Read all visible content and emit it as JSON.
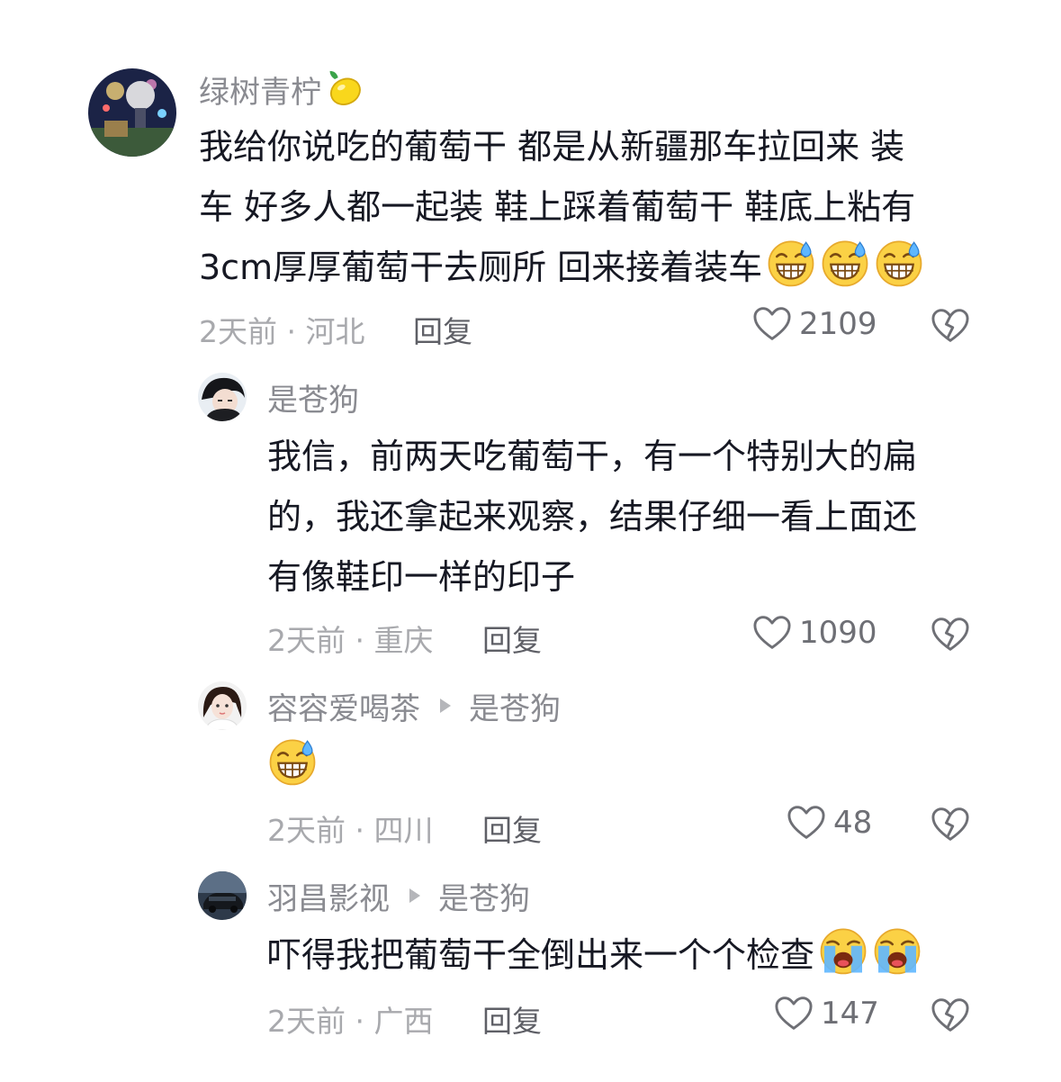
{
  "comments": [
    {
      "username": "绿树青柠",
      "text": [
        "我给你说吃的葡萄干 都是从新疆那车拉回来 装",
        "车 好多人都一起装 鞋上踩着葡萄干 鞋底上粘有",
        "3cm厚厚葡萄干去厕所 回来接着装车"
      ],
      "meta": "2天前 · 河北",
      "reply_label": "回复",
      "likes": "2109"
    },
    {
      "username": "是苍狗",
      "text": [
        "我信，前两天吃葡萄干，有一个特别大的扁",
        "的，我还拿起来观察，结果仔细一看上面还",
        "有像鞋印一样的印子"
      ],
      "meta": "2天前 · 重庆",
      "reply_label": "回复",
      "likes": "1090"
    },
    {
      "username": "容容爱喝茶",
      "reply_to": "是苍狗",
      "meta": "2天前 · 四川",
      "reply_label": "回复",
      "likes": "48"
    },
    {
      "username": "羽昌影视",
      "reply_to": "是苍狗",
      "text": [
        "吓得我把葡萄干全倒出来一个个检查"
      ],
      "meta": "2天前 · 广西",
      "reply_label": "回复",
      "likes": "147"
    }
  ],
  "icons": {
    "lemon": "lemon-emoji",
    "grin_sweat": "grinning-sweat-emoji",
    "crying": "loudly-crying-emoji",
    "like": "heart-icon",
    "dislike": "broken-heart-icon"
  }
}
